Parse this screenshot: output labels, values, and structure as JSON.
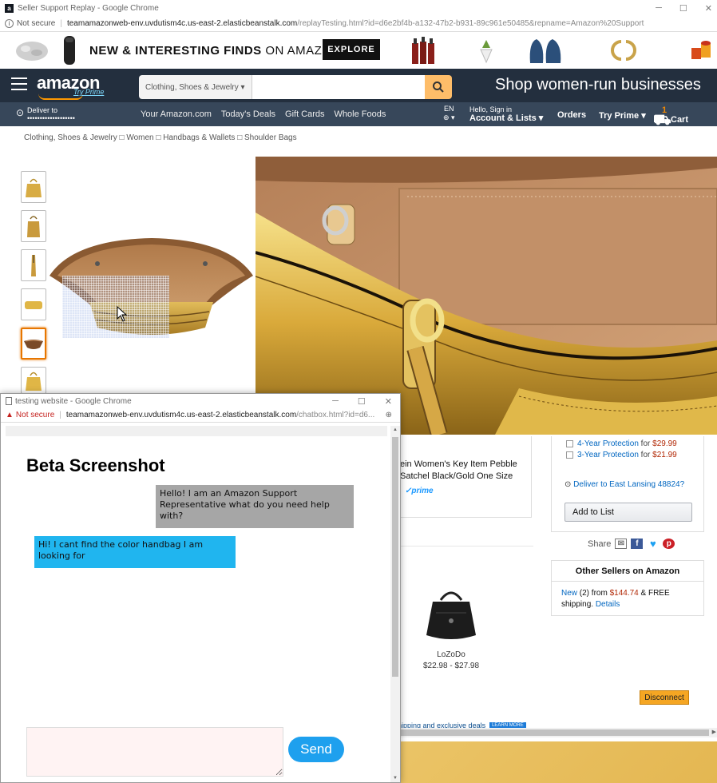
{
  "main_window": {
    "tab_title": "Seller Support Replay - Google Chrome",
    "address": {
      "security": "Not secure",
      "host": "teamamazonweb-env.uvdutism4c.us-east-2.elasticbeanstalk.com",
      "rest": "/replayTesting.html?id=d6e2bf4b-a132-47b2-b931-89c961e50485&repname=Amazon%20Support"
    }
  },
  "promo": {
    "headline_bold": "NEW & INTERESTING FINDS",
    "headline_rest": " ON AMAZON",
    "explore": "EXPLORE"
  },
  "nav": {
    "logo": "amazon",
    "try_prime": "Try Prime",
    "search_dept": "Clothing, Shoes & Jewelry ▾",
    "shop_women": "Shop women-run businesses",
    "deliver_to": "Deliver to",
    "deliver_addr": "•••••••••••••••••••",
    "links": [
      "Your Amazon.com",
      "Today's Deals",
      "Gift Cards",
      "Whole Foods"
    ],
    "lang": "EN",
    "lang_icon": "⊕ ▾",
    "hello": "Hello, Sign in",
    "account": "Account & Lists ▾",
    "orders": "Orders",
    "try_prime_menu": "Try Prime ▾",
    "cart_count": "1",
    "cart_label": "Cart"
  },
  "breadcrumb": "Clothing, Shoes & Jewelry □ Women □ Handbags & Wallets □ Shoulder Bags",
  "product": {
    "related_title": "ein Women's Key Item Pebble Satchel Black/Gold One Size",
    "prime": "✓prime",
    "protection": [
      {
        "label": "4-Year Protection",
        "for": " for ",
        "price": "$29.99"
      },
      {
        "label": "3-Year Protection",
        "for": " for ",
        "price": "$21.99"
      }
    ],
    "deliver": "Deliver to East Lansing 48824?",
    "add_to_list": "Add to List",
    "share": "Share",
    "other_sellers_title": "Other Sellers on Amazon",
    "other_new": "New",
    "other_count": " (2) from ",
    "other_price": "$144.74",
    "other_free": " & FREE shipping. ",
    "other_details": "Details",
    "related_name": "LoZoDo",
    "related_price": "$22.98 - $27.98",
    "disconnect": "Disconnect",
    "banner_text": "hipping and exclusive deals",
    "banner_btn": "LEARN MORE"
  },
  "chat_window": {
    "tab_title": "testing website - Google Chrome",
    "address": {
      "security": "Not secure",
      "host": "teamamazonweb-env.uvdutism4c.us-east-2.elasticbeanstalk.com",
      "rest": "/chatbox.html?id=d6..."
    },
    "title": "Beta Screenshot",
    "messages": [
      {
        "from": "agent",
        "text": "Hello! I am an Amazon Support Representative what do you need help with?"
      },
      {
        "from": "user",
        "text": "Hi! I cant find the color handbag I am looking for"
      }
    ],
    "input_value": "",
    "send": "Send"
  },
  "colors": {
    "amazon_nav": "#232f3e",
    "amazon_subnav": "#37475a",
    "accent_orange": "#ff9900",
    "agent_bubble": "#a6a6a6",
    "user_bubble": "#20b5ef",
    "send_button": "#1ea0ee"
  }
}
